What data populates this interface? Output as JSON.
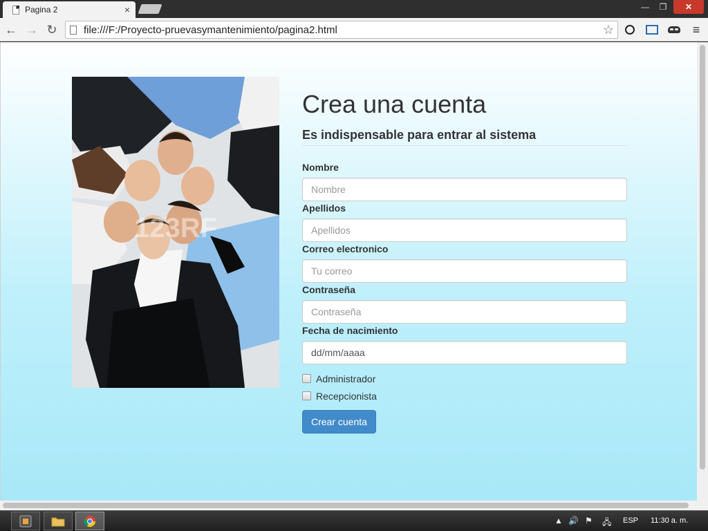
{
  "browser": {
    "tab_title": "Pagina 2",
    "tab_close": "×",
    "url": "file:///F:/Proyecto-pruevasymantenimiento/pagina2.html"
  },
  "form": {
    "title": "Crea una cuenta",
    "subtitle": "Es indispensable para entrar al sistema",
    "fields": [
      {
        "label": "Nombre",
        "placeholder": "Nombre"
      },
      {
        "label": "Apellidos",
        "placeholder": "Apellidos"
      },
      {
        "label": "Correo electronico",
        "placeholder": "Tu correo"
      },
      {
        "label": "Contraseña",
        "placeholder": "Contraseña"
      },
      {
        "label": "Fecha de nacimiento",
        "value": "dd/mm/aaaa"
      }
    ],
    "checkboxes": [
      {
        "label": "Administrador",
        "checked": false
      },
      {
        "label": "Recepcionista",
        "checked": false
      }
    ],
    "submit_label": "Crear cuenta"
  },
  "photo": {
    "watermark": "123RF"
  },
  "taskbar": {
    "language": "ESP",
    "clock": "11:30 a. m."
  },
  "colors": {
    "accent": "#428bca",
    "page_gradient_top": "#ffffff",
    "page_gradient_bottom": "#a8e8f8",
    "close_button": "#c7392b"
  },
  "icons": {
    "back": "arrow-left-icon",
    "forward": "arrow-right-icon",
    "reload": "reload-icon",
    "bookmark": "star-icon",
    "menu": "hamburger-menu-icon"
  }
}
